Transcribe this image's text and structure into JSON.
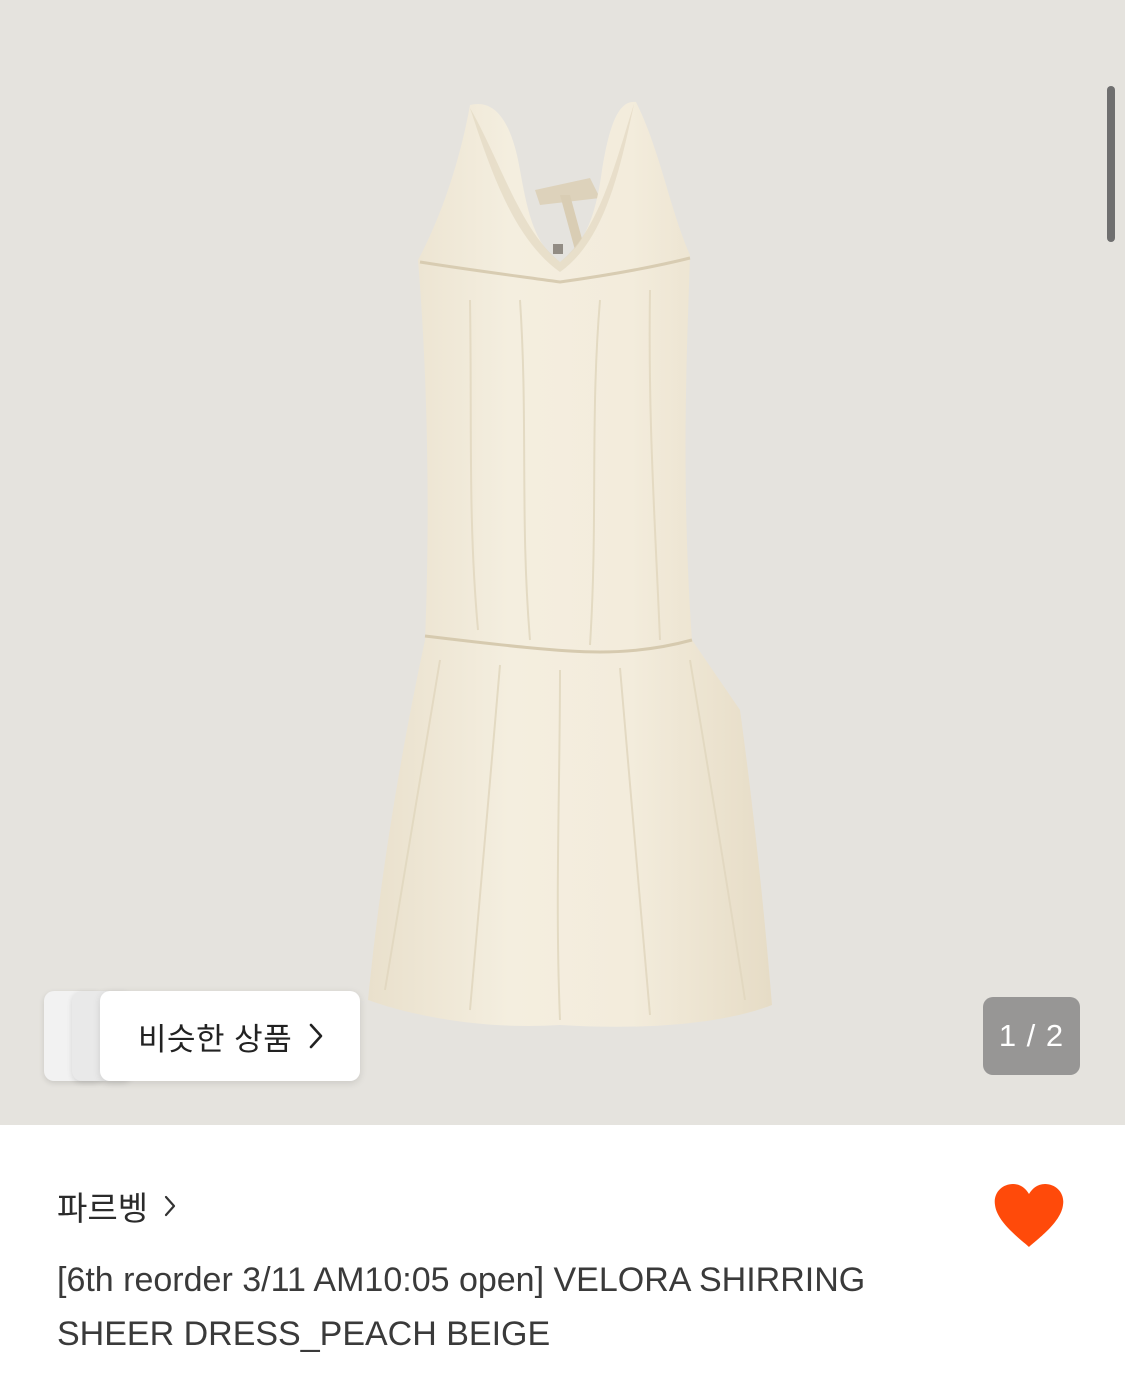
{
  "gallery": {
    "similar_button_label": "비슷한 상품",
    "counter": "1 / 2",
    "background_color": "#e5e3de",
    "product_color": "#f1ead8"
  },
  "product": {
    "brand": "파르벵",
    "title": "[6th reorder 3/11 AM10:05 open] VELORA SHIRRING SHEER DRESS_PEACH BEIGE",
    "wishlisted": true,
    "heart_color": "#ff4a0a"
  },
  "icons": {
    "similar_chevron": "chevron-right-icon",
    "brand_chevron": "chevron-right-icon",
    "wishlist": "heart-icon"
  }
}
